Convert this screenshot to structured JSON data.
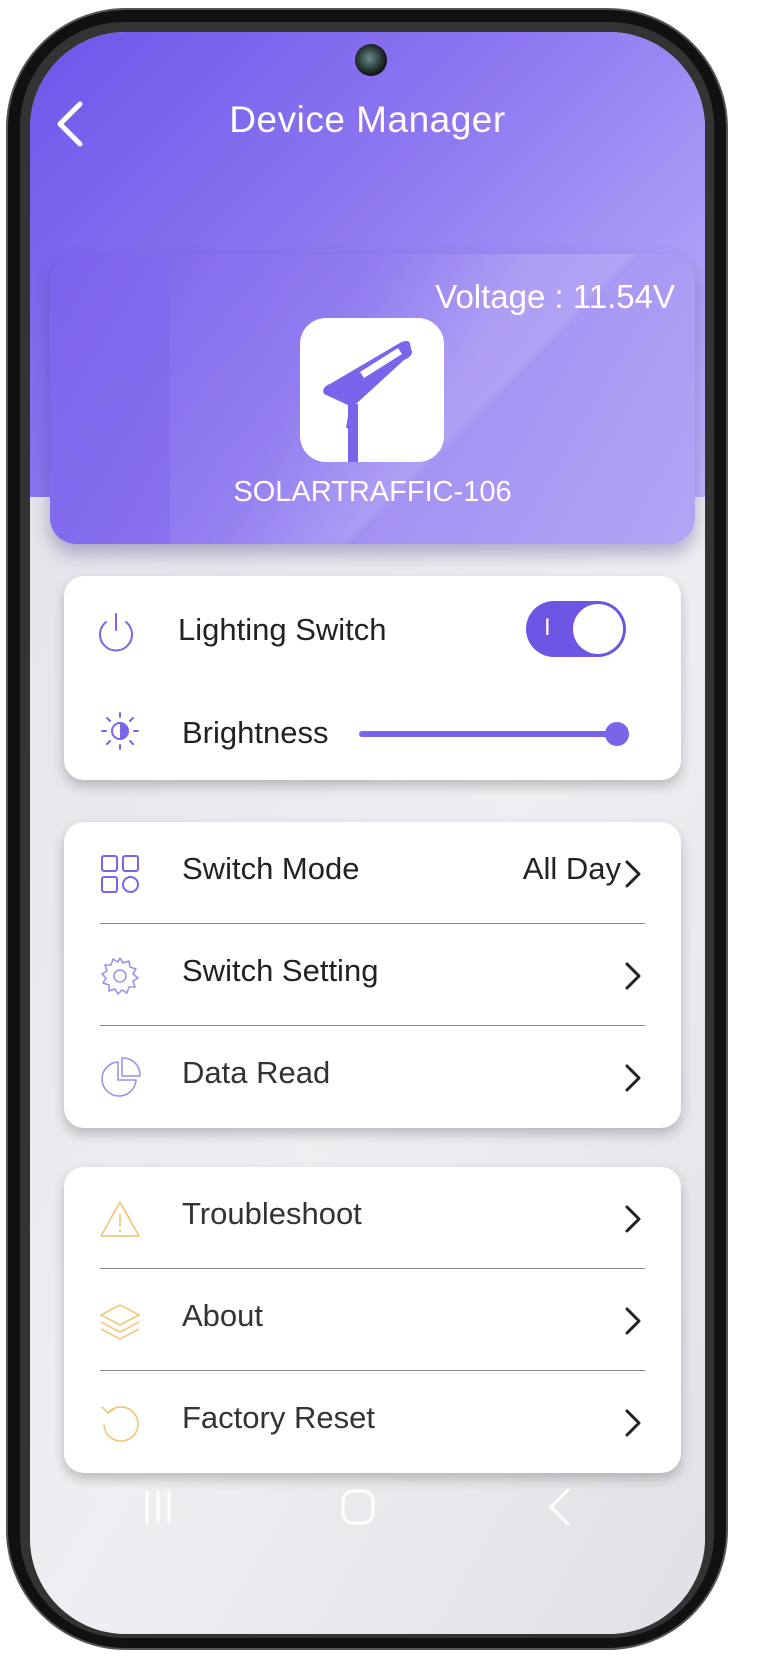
{
  "header": {
    "title": "Device Manager"
  },
  "device": {
    "voltage_text": "Voltage : 11.54V",
    "name": "SOLARTRAFFIC-106"
  },
  "controls": {
    "lighting_label": "Lighting Switch",
    "lighting_on": true,
    "toggle_on_mark": "I",
    "brightness_label": "Brightness",
    "brightness_level": 1.0
  },
  "menu_main": [
    {
      "label": "Switch Mode",
      "value": "All Day",
      "icon": "grid-icon"
    },
    {
      "label": "Switch Setting",
      "value": "",
      "icon": "gear-icon"
    },
    {
      "label": "Data Read",
      "value": "",
      "icon": "pie-chart-icon"
    }
  ],
  "menu_extra": [
    {
      "label": "Troubleshoot",
      "icon": "warning-icon"
    },
    {
      "label": "About",
      "icon": "layers-icon"
    },
    {
      "label": "Factory Reset",
      "icon": "reset-icon"
    }
  ],
  "colors": {
    "accent": "#6f55e4",
    "secondary_icon": "#f2c06e",
    "text": "#222222"
  }
}
